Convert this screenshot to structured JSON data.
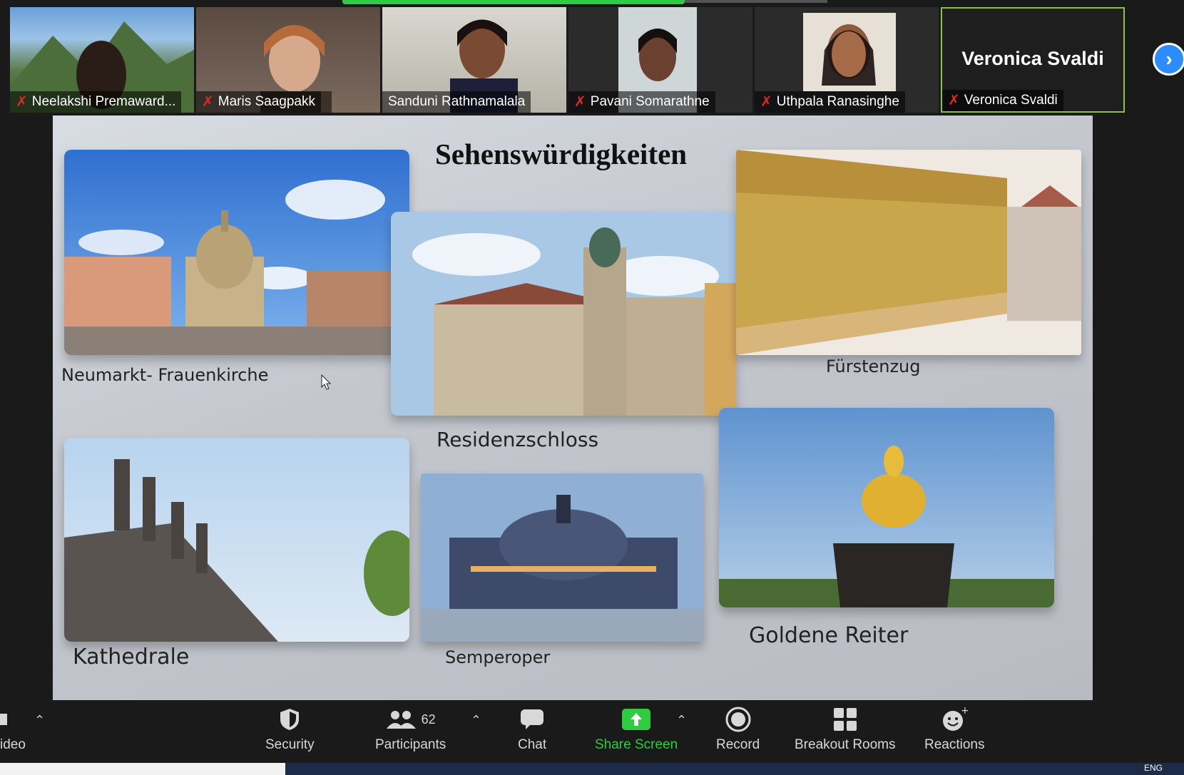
{
  "gallery": {
    "participants": [
      {
        "name": "Neelakshi Premaward...",
        "muted": true
      },
      {
        "name": "Maris Saagpakk",
        "muted": true
      },
      {
        "name": "Sanduni Rathnamalala",
        "muted": false
      },
      {
        "name": "Pavani Somarathne",
        "muted": true
      },
      {
        "name": "Uthpala Ranasinghe",
        "muted": true
      },
      {
        "name": "Veronica Svaldi",
        "muted": true,
        "big_name": "Veronica Svaldi"
      }
    ],
    "next_icon": "chevron-right-icon"
  },
  "slide": {
    "title": "Sehenswürdigkeiten",
    "captions": {
      "neumarkt": "Neumarkt- Frauenkirche",
      "residenz": "Residenzschloss",
      "fuerstenzug": "Fürstenzug",
      "kathedrale": "Kathedrale",
      "semperoper": "Semperoper",
      "goldene": "Goldene Reiter"
    }
  },
  "controls": {
    "video_label": "ideo",
    "security_label": "Security",
    "participants_label": "Participants",
    "participants_count": "62",
    "chat_label": "Chat",
    "share_label": "Share Screen",
    "record_label": "Record",
    "breakout_label": "Breakout Rooms",
    "reactions_label": "Reactions"
  },
  "taskbar": {
    "lang": "ENG"
  },
  "colors": {
    "accent_blue": "#2d8cff",
    "share_green": "#2ecc40",
    "muted_red": "#e0282b",
    "active_border": "#8ac43f"
  }
}
